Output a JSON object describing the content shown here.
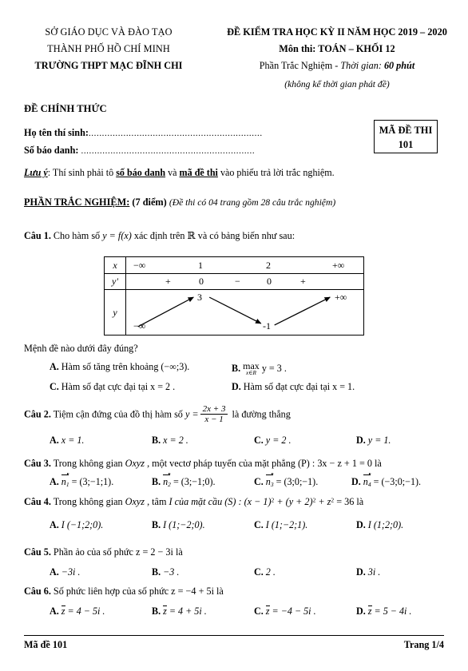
{
  "header": {
    "left_line1": "SỞ GIÁO DỤC VÀ ĐÀO TẠO",
    "left_line2": "THÀNH PHỐ HỒ CHÍ MINH",
    "left_line3": "TRƯỜNG THPT MẠC ĐĨNH CHI",
    "right_line1": "ĐỀ KIỂM TRA HỌC KỲ II NĂM HỌC 2019 – 2020",
    "right_line2": "Môn thi: TOÁN – KHỐI 12",
    "right_line3_prefix": "Phần Trắc Nghiệm - ",
    "right_line3_italic": "Thời gian: ",
    "right_line3_bolditalic": "60 phút",
    "right_line4": "(không kể thời gian phát đề)",
    "official_label": "ĐỀ CHÍNH THỨC"
  },
  "student": {
    "name_label": "Họ tên thí sinh:",
    "name_dots": ".................................................................",
    "sbd_label": "Số báo danh: ",
    "sbd_dots": ".................................................................",
    "code_box_title": "MÃ ĐỀ THI",
    "code_box_value": "101"
  },
  "note": {
    "prefix": "Lưu ý",
    "colon": ": Thí sinh phải tô ",
    "em1": "số báo danh",
    "mid": " và ",
    "em2": "mã đề thi",
    "suffix": " vào phiếu trả lời trắc nghiệm."
  },
  "section": {
    "title": "PHẦN TRẮC NGHIỆM:",
    "points": "(7 điểm)",
    "description": "(Đề thi có 04 trang gồm 28 câu trắc nghiệm)"
  },
  "questions": {
    "q1": {
      "label": "Câu 1.",
      "stem_a": " Cho hàm số ",
      "stem_math": "y = f(x)",
      "stem_b": " xác định trên ℝ  và có bảng biến như sau:",
      "sub_prompt": "Mệnh đề nào dưới đây đúng?",
      "options": [
        {
          "key": "A.",
          "text": "Hàm số tăng trên khoảng (−∞;3)."
        },
        {
          "key": "B.",
          "text": "max y = 3 .",
          "op_top": "max",
          "op_bot": "x∈R",
          "op_rest": "y = 3 ."
        },
        {
          "key": "C.",
          "text": "Hàm số đạt cực đại tại x = 2 ."
        },
        {
          "key": "D.",
          "text": "Hàm số đạt cực đại tại x = 1."
        }
      ]
    },
    "q2": {
      "label": "Câu 2.",
      "stem_a": " Tiệm cận đứng của đồ thị hàm số ",
      "stem_y": "y =",
      "frac_num": "2x + 3",
      "frac_den": "x − 1",
      "stem_b": " là đường thẳng",
      "options": [
        {
          "key": "A.",
          "text": "x = 1."
        },
        {
          "key": "B.",
          "text": "x = 2 ."
        },
        {
          "key": "C.",
          "text": "y = 2 ."
        },
        {
          "key": "D.",
          "text": "y = 1."
        }
      ]
    },
    "q3": {
      "label": "Câu 3.",
      "stem_a": " Trong không gian ",
      "stem_oxyz": "Oxyz",
      "stem_b": " , một vectơ pháp tuyến của mặt phẳng (P) : 3x − z + 1 = 0 là",
      "options": [
        {
          "key": "A.",
          "vec": "n",
          "idx": "1",
          "rest": " = (3;−1;1)."
        },
        {
          "key": "B.",
          "vec": "n",
          "idx": "2",
          "rest": " = (3;−1;0)."
        },
        {
          "key": "C.",
          "vec": "n",
          "idx": "3",
          "rest": " = (3;0;−1)."
        },
        {
          "key": "D.",
          "vec": "n",
          "idx": "4",
          "rest": " = (−3;0;−1)."
        }
      ]
    },
    "q4": {
      "label": "Câu 4.",
      "stem_a": " Trong không gian ",
      "stem_oxyz": "Oxyz",
      "stem_b": " , tâm ",
      "stem_i": "I",
      "stem_c": " của mặt cầu (S) : (x − 1)",
      "stem_sup1": "2",
      "stem_d": " + (y + 2)",
      "stem_sup2": "2",
      "stem_e": " + z",
      "stem_sup3": "2",
      "stem_f": " = 36 là",
      "options": [
        {
          "key": "A.",
          "text": "I (−1;2;0)."
        },
        {
          "key": "B.",
          "text": "I (1;−2;0)."
        },
        {
          "key": "C.",
          "text": "I (1;−2;1)."
        },
        {
          "key": "D.",
          "text": "I (1;2;0)."
        }
      ]
    },
    "q5": {
      "label": "Câu 5.",
      "stem": " Phần ảo của số phức z = 2 − 3i là",
      "options": [
        {
          "key": "A.",
          "text": "−3i ."
        },
        {
          "key": "B.",
          "text": "−3 ."
        },
        {
          "key": "C.",
          "text": "2 ."
        },
        {
          "key": "D.",
          "text": "3i ."
        }
      ]
    },
    "q6": {
      "label": "Câu 6.",
      "stem": " Số phức liên hợp của số phức z = −4 + 5i là",
      "options": [
        {
          "key": "A.",
          "bar": "z",
          "rest": " = 4 − 5i ."
        },
        {
          "key": "B.",
          "bar": "z",
          "rest": " = 4 + 5i ."
        },
        {
          "key": "C.",
          "bar": "z",
          "rest": " = −4 − 5i ."
        },
        {
          "key": "D.",
          "bar": "z",
          "rest": " = 5 − 4i ."
        }
      ]
    }
  },
  "variation_table": {
    "row_labels": {
      "x": "x",
      "yprime": "y'",
      "y": "y"
    },
    "x_values": [
      "−∞",
      "1",
      "2",
      "+∞"
    ],
    "yprime_signs": [
      "+",
      "0",
      "−",
      "0",
      "+"
    ],
    "y_values": {
      "start": "−∞",
      "max": "3",
      "min": "-1",
      "end": "+∞"
    }
  },
  "footer": {
    "left": "Mã đề 101",
    "right": "Trang 1/4"
  }
}
